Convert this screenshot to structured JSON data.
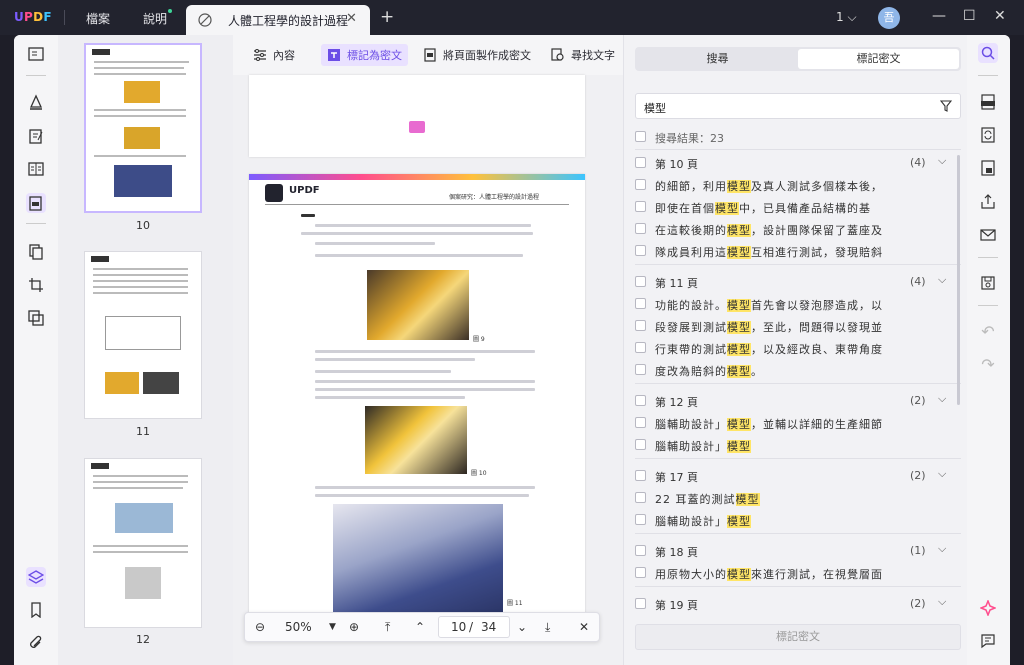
{
  "titlebar": {
    "logo": "UPDF",
    "menu_file": "檔案",
    "menu_help": "說明",
    "tab_title": "人體工程學的設計過程",
    "page_indicator": "1",
    "avatar_initial": "吾"
  },
  "thumbnails": [
    {
      "page": "10",
      "selected": true
    },
    {
      "page": "11",
      "selected": false
    },
    {
      "page": "12",
      "selected": false
    }
  ],
  "toolbar": {
    "outline": "內容",
    "mark_redaction": "標記為密文",
    "redact_pages": "將頁面製作成密文",
    "find_text": "尋找文字"
  },
  "document": {
    "header_logo": "UPDF",
    "header_title": "個案研究：人體工程學的設計過程",
    "fig9": "圖 9",
    "fig10": "圖 10",
    "fig11": "圖 11"
  },
  "zoom": {
    "level": "50%",
    "current_page": "10",
    "separator": "/",
    "total_pages": "34"
  },
  "panel": {
    "tab_search": "搜尋",
    "tab_redact": "標記密文",
    "query": "模型",
    "results_label": "搜尋結果：23",
    "groups": [
      {
        "page": "第 10 頁",
        "count": "(4)",
        "items": [
          {
            "pre": "的細節，利用",
            "hit": "模型",
            "post": "及真人測試多個樣本後，"
          },
          {
            "pre": "即使在首個",
            "hit": "模型",
            "post": "中，已具備產品結構的基"
          },
          {
            "pre": "在這較後期的",
            "hit": "模型",
            "post": "，設計團隊保留了蓋座及"
          },
          {
            "pre": "隊成員利用這",
            "hit": "模型",
            "post": "互相進行測試，發現賠斜"
          }
        ]
      },
      {
        "page": "第 11 頁",
        "count": "(4)",
        "items": [
          {
            "pre": "功能的設計。",
            "hit": "模型",
            "post": "首先會以發泡膠造成，以"
          },
          {
            "pre": "段發展到測試",
            "hit": "模型",
            "post": "，至此，問題得以發現並"
          },
          {
            "pre": "行東帶的測試",
            "hit": "模型",
            "post": "，以及經改良、東帶角度"
          },
          {
            "pre": "度改為賠斜的",
            "hit": "模型",
            "post": "。"
          }
        ]
      },
      {
        "page": "第 12 頁",
        "count": "(2)",
        "items": [
          {
            "pre": "腦輔助設計」",
            "hit": "模型",
            "post": "，並輔以詳細的生產細節"
          },
          {
            "pre": "腦輔助設計」",
            "hit": "模型",
            "post": ""
          }
        ]
      },
      {
        "page": "第 17 頁",
        "count": "(2)",
        "items": [
          {
            "pre": "22 耳蓋的測試",
            "hit": "模型",
            "post": ""
          },
          {
            "pre": "腦輔助設計」",
            "hit": "模型",
            "post": ""
          }
        ]
      },
      {
        "page": "第 18 頁",
        "count": "(1)",
        "items": [
          {
            "pre": "用原物大小的",
            "hit": "模型",
            "post": "來進行測試，在視覺層面"
          }
        ]
      },
      {
        "page": "第 19 頁",
        "count": "(2)",
        "items": []
      }
    ],
    "mark_button": "標記密文"
  },
  "colors": {
    "accent": "#7c5cff",
    "highlight": "#ffe566",
    "titlebar_bg": "#22232e"
  }
}
